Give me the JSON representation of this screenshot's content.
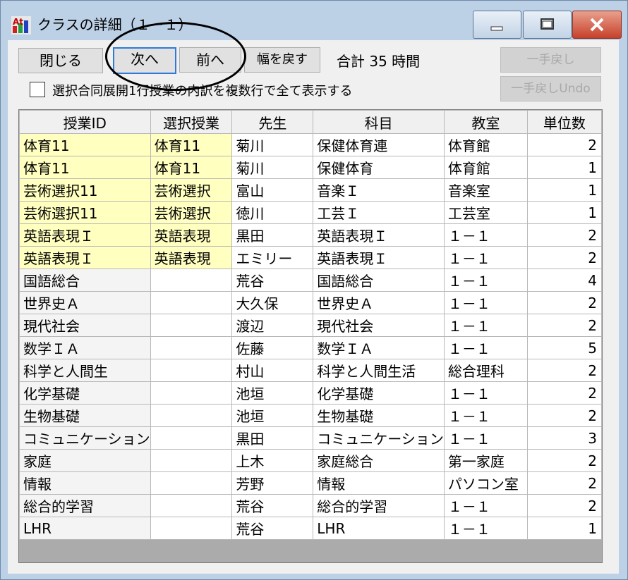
{
  "window": {
    "title": "クラスの詳細（１－１）",
    "app_icon": "app-logo-icon",
    "controls": {
      "minimize_icon": "minimize-icon",
      "maximize_icon": "maximize-icon",
      "close_icon": "close-icon"
    }
  },
  "toolbar": {
    "close_label": "閉じる",
    "next_label": "次へ",
    "prev_label": "前へ",
    "reset_width_label": "幅を戻す",
    "total_text": "合計 35 時間",
    "undo_label": "一手戻し",
    "undo2_label": "一手戻しUndo"
  },
  "option": {
    "checkbox_label": "選択合同展開1行授業の内訳を複数行で全て表示する",
    "checked": false
  },
  "table": {
    "headers": [
      "授業ID",
      "選択授業",
      "先生",
      "科目",
      "教室",
      "単位数"
    ],
    "rows": [
      {
        "id": "体育11",
        "select": "体育11",
        "teacher": "菊川",
        "subject": "保健体育連",
        "room": "体育館",
        "units": "2",
        "hl": true
      },
      {
        "id": "体育11",
        "select": "体育11",
        "teacher": "菊川",
        "subject": "保健体育",
        "room": "体育館",
        "units": "1",
        "hl": true
      },
      {
        "id": "芸術選択11",
        "select": "芸術選択",
        "teacher": "富山",
        "subject": "音楽Ｉ",
        "room": "音楽室",
        "units": "1",
        "hl": true
      },
      {
        "id": "芸術選択11",
        "select": "芸術選択",
        "teacher": "徳川",
        "subject": "工芸Ｉ",
        "room": "工芸室",
        "units": "1",
        "hl": true
      },
      {
        "id": "英語表現Ｉ",
        "select": "英語表現",
        "teacher": "黒田",
        "subject": "英語表現Ｉ",
        "room": "１－１",
        "units": "2",
        "hl": true
      },
      {
        "id": "英語表現Ｉ",
        "select": "英語表現",
        "teacher": "エミリー",
        "subject": "英語表現Ｉ",
        "room": "１－１",
        "units": "2",
        "hl": true
      },
      {
        "id": "国語総合",
        "select": "",
        "teacher": "荒谷",
        "subject": "国語総合",
        "room": "１－１",
        "units": "4",
        "hl": false
      },
      {
        "id": "世界史Ａ",
        "select": "",
        "teacher": "大久保",
        "subject": "世界史Ａ",
        "room": "１－１",
        "units": "2",
        "hl": false
      },
      {
        "id": "現代社会",
        "select": "",
        "teacher": "渡辺",
        "subject": "現代社会",
        "room": "１－１",
        "units": "2",
        "hl": false
      },
      {
        "id": "数学ＩＡ",
        "select": "",
        "teacher": "佐藤",
        "subject": "数学ＩＡ",
        "room": "１－１",
        "units": "5",
        "hl": false
      },
      {
        "id": "科学と人間生",
        "select": "",
        "teacher": "村山",
        "subject": "科学と人間生活",
        "room": "総合理科",
        "units": "2",
        "hl": false
      },
      {
        "id": "化学基礎",
        "select": "",
        "teacher": "池垣",
        "subject": "化学基礎",
        "room": "１－１",
        "units": "2",
        "hl": false
      },
      {
        "id": "生物基礎",
        "select": "",
        "teacher": "池垣",
        "subject": "生物基礎",
        "room": "１－１",
        "units": "2",
        "hl": false
      },
      {
        "id": "コミュニケーション",
        "select": "",
        "teacher": "黒田",
        "subject": "コミュニケーション",
        "room": "１－１",
        "units": "3",
        "hl": false
      },
      {
        "id": "家庭",
        "select": "",
        "teacher": "上木",
        "subject": "家庭総合",
        "room": "第一家庭",
        "units": "2",
        "hl": false
      },
      {
        "id": "情報",
        "select": "",
        "teacher": "芳野",
        "subject": "情報",
        "room": "パソコン室",
        "units": "2",
        "hl": false
      },
      {
        "id": "総合的学習",
        "select": "",
        "teacher": "荒谷",
        "subject": "総合的学習",
        "room": "１－１",
        "units": "2",
        "hl": false
      },
      {
        "id": "LHR",
        "select": "",
        "teacher": "荒谷",
        "subject": "LHR",
        "room": "１－１",
        "units": "1",
        "hl": false
      }
    ]
  },
  "colors": {
    "highlight_row": "#ffffc0",
    "titlebar": "#bcd0e6",
    "close_button": "#c6402a",
    "focus_border": "#2f7ad6"
  }
}
